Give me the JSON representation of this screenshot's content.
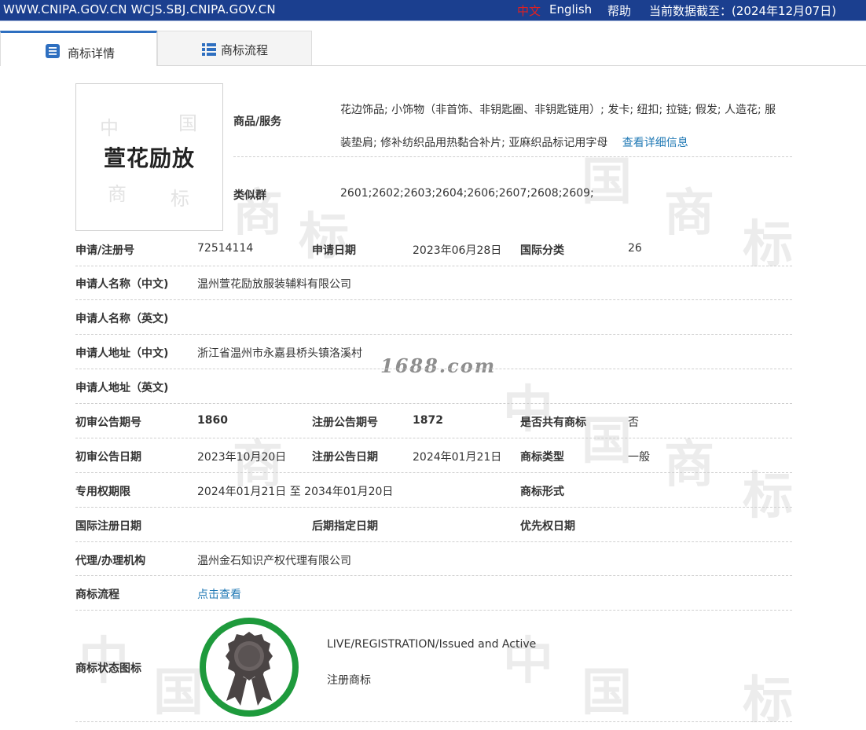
{
  "topbar": {
    "site": "WWW.CNIPA.GOV.CN WCJS.SBJ.CNIPA.GOV.CN",
    "lang_zh": "中文",
    "lang_en": "English",
    "help": "帮助",
    "data_date": "当前数据截至：(2024年12月07日)"
  },
  "tabs": [
    {
      "label": "商标详情",
      "icon": "document-list-icon",
      "active": true
    },
    {
      "label": "商标流程",
      "icon": "list-icon",
      "active": false
    }
  ],
  "mark": {
    "name": "萱花励放"
  },
  "goods": {
    "label": "商品/服务",
    "value": "花边饰品; 小饰物（非首饰、非钥匙圈、非钥匙链用）; 发卡; 纽扣; 拉链; 假发; 人造花; 服装垫肩; 修补纺织品用热黏合补片; 亚麻织品标记用字母",
    "detail_link": "查看详细信息"
  },
  "similar_group": {
    "label": "类似群",
    "value": "2601;2602;2603;2604;2606;2607;2608;2609;"
  },
  "fields": {
    "reg_no_label": "申请/注册号",
    "reg_no": "72514114",
    "apply_date_label": "申请日期",
    "apply_date": "2023年06月28日",
    "intl_class_label": "国际分类",
    "intl_class": "26",
    "applicant_cn_label": "申请人名称（中文)",
    "applicant_cn": "温州萱花励放服装辅料有限公司",
    "applicant_en_label": "申请人名称（英文)",
    "applicant_en": "",
    "address_cn_label": "申请人地址（中文)",
    "address_cn": "浙江省温州市永嘉县桥头镇洛溪村",
    "address_en_label": "申请人地址（英文)",
    "address_en": "",
    "prelim_no_label": "初审公告期号",
    "prelim_no": "1860",
    "reg_pub_no_label": "注册公告期号",
    "reg_pub_no": "1872",
    "shared_label": "是否共有商标",
    "shared": "否",
    "prelim_date_label": "初审公告日期",
    "prelim_date": "2023年10月20日",
    "reg_pub_date_label": "注册公告日期",
    "reg_pub_date": "2024年01月21日",
    "mark_type_label": "商标类型",
    "mark_type": "一般",
    "exclusive_label": "专用权期限",
    "exclusive": "2024年01月21日 至 2034年01月20日",
    "mark_form_label": "商标形式",
    "mark_form": "",
    "intl_reg_date_label": "国际注册日期",
    "intl_reg_date": "",
    "later_date_label": "后期指定日期",
    "later_date": "",
    "priority_date_label": "优先权日期",
    "priority_date": "",
    "agent_label": "代理/办理机构",
    "agent": "温州金石知识产权代理有限公司",
    "flow_label": "商标流程",
    "flow_link": "点击查看",
    "status_label": "商标状态图标",
    "status_en": "LIVE/REGISTRATION/Issued and Active",
    "status_cn": "注册商标"
  },
  "watermark": {
    "site_text": "1688.com"
  },
  "colors": {
    "topbar_bg": "#1b3f8f",
    "link": "#1f78b4",
    "seal_ring": "#1e9a3c",
    "seal_badge": "#4a4444"
  }
}
